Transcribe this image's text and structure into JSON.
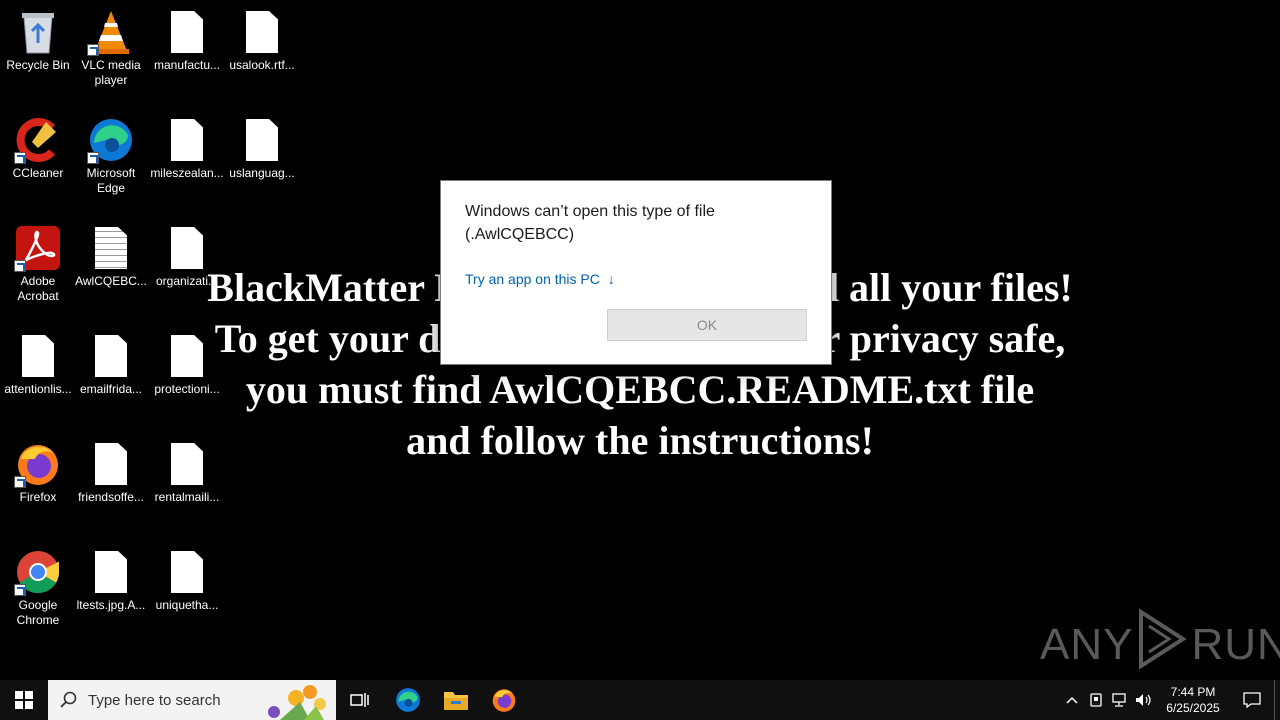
{
  "desktop": {
    "icons": [
      {
        "label": "Recycle Bin",
        "icon": "recycle-bin-icon"
      },
      {
        "label": "VLC media player",
        "icon": "vlc-icon"
      },
      {
        "label": "manufactu...",
        "icon": "file-icon"
      },
      {
        "label": "usalook.rtf...",
        "icon": "file-icon"
      },
      {
        "label": "CCleaner",
        "icon": "ccleaner-icon"
      },
      {
        "label": "Microsoft Edge",
        "icon": "edge-icon"
      },
      {
        "label": "mileszealan...",
        "icon": "file-icon"
      },
      {
        "label": "uslanguag...",
        "icon": "file-icon"
      },
      {
        "label": "Adobe Acrobat",
        "icon": "acrobat-icon"
      },
      {
        "label": "AwlCQEBC...",
        "icon": "text-file-icon"
      },
      {
        "label": "organizati...",
        "icon": "file-icon"
      },
      {
        "label": "attentionlis...",
        "icon": "file-icon"
      },
      {
        "label": "emailfrida...",
        "icon": "file-icon"
      },
      {
        "label": "protectioni...",
        "icon": "file-icon"
      },
      {
        "label": "Firefox",
        "icon": "firefox-icon"
      },
      {
        "label": "friendsoffe...",
        "icon": "file-icon"
      },
      {
        "label": "rentalmaili...",
        "icon": "file-icon"
      },
      {
        "label": "Google Chrome",
        "icon": "chrome-icon"
      },
      {
        "label": "ltests.jpg.A...",
        "icon": "file-icon"
      },
      {
        "label": "uniquetha...",
        "icon": "file-icon"
      }
    ]
  },
  "ransom": {
    "line1": "BlackMatter Ransomware encrypted all your files!",
    "line2": "To get your data back and keep your privacy safe,",
    "line3": "you must find AwlCQEBCC.README.txt file",
    "line4": "and follow the instructions!"
  },
  "dialog": {
    "message_line1": "Windows can’t open this type of file",
    "message_line2": "(.AwlCQEBCC)",
    "try_link": "Try an app on this PC",
    "try_link_arrow": "↓",
    "ok_button": "OK"
  },
  "watermark": {
    "left": "ANY",
    "right": "RUN"
  },
  "taskbar": {
    "search_placeholder": "Type here to search",
    "time": "7:44 PM",
    "date": "6/25/2025"
  },
  "colors": {
    "desktop_bg": "#000000",
    "link": "#0063b1",
    "taskbar_bg": "#101010"
  }
}
